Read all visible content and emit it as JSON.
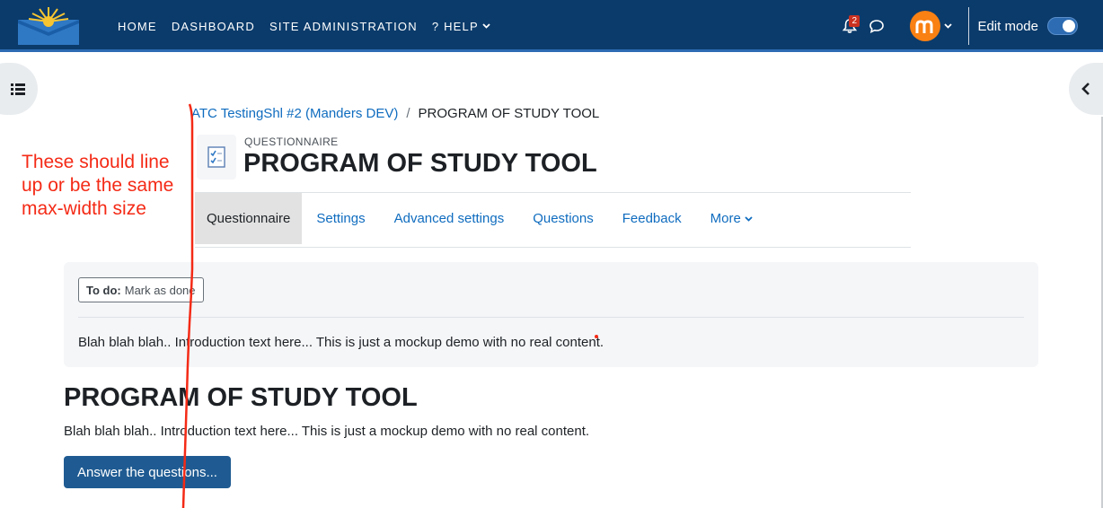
{
  "nav": {
    "links": [
      {
        "label": "HOME"
      },
      {
        "label": "DASHBOARD"
      },
      {
        "label": "SITE ADMINISTRATION"
      },
      {
        "label": "? HELP"
      }
    ],
    "notification_count": "2",
    "edit_mode_label": "Edit mode",
    "edit_mode_on": true
  },
  "breadcrumb": {
    "course": "ATC TestingShl #2 (Manders DEV)",
    "separator": "/",
    "current": "PROGRAM OF STUDY TOOL"
  },
  "header": {
    "activity_type": "QUESTIONNAIRE",
    "title": "PROGRAM OF STUDY TOOL"
  },
  "secondary_nav": {
    "tabs": [
      {
        "label": "Questionnaire",
        "active": true
      },
      {
        "label": "Settings"
      },
      {
        "label": "Advanced settings"
      },
      {
        "label": "Questions"
      },
      {
        "label": "Feedback"
      },
      {
        "label": "More"
      }
    ]
  },
  "intro": {
    "todo_prefix": "To do:",
    "todo_label": "Mark as done",
    "text": "Blah blah blah.. Introduction text here... This is just a mockup demo with no real content."
  },
  "content": {
    "title": "PROGRAM OF STUDY TOOL",
    "text": "Blah blah blah.. Introduction text here... This is just a mockup demo with no real content.",
    "button_label": "Answer the questions..."
  },
  "annotation": {
    "text": "These should line up or be the same max-width size",
    "color": "#f42a16"
  },
  "colors": {
    "navbar": "#0b3b6b",
    "link": "#0f6cbf",
    "primary_button": "#1f5b92",
    "avatar": "#f98012"
  },
  "icons": {
    "notification": "bell-icon",
    "messages": "chat-bubble-icon",
    "left_drawer": "list-icon",
    "right_drawer": "chevron-left-icon",
    "activity": "questionnaire-icon"
  }
}
